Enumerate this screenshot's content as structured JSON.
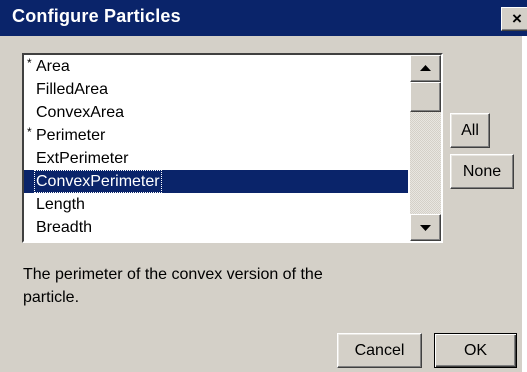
{
  "window": {
    "title": "Configure Particles",
    "close_glyph": "×",
    "close_icon": "close-icon"
  },
  "particle_list": {
    "items": [
      {
        "label": "Area",
        "marker": "*",
        "indent": false,
        "selected": false
      },
      {
        "label": "FilledArea",
        "marker": "",
        "indent": true,
        "selected": false
      },
      {
        "label": "ConvexArea",
        "marker": "",
        "indent": true,
        "selected": false
      },
      {
        "label": "Perimeter",
        "marker": "*",
        "indent": false,
        "selected": false
      },
      {
        "label": "ExtPerimeter",
        "marker": "",
        "indent": true,
        "selected": false
      },
      {
        "label": "ConvexPerimeter",
        "marker": "",
        "indent": true,
        "selected": true
      },
      {
        "label": "Length",
        "marker": "",
        "indent": true,
        "selected": false
      },
      {
        "label": "Breadth",
        "marker": "",
        "indent": true,
        "selected": false
      }
    ],
    "scroll_up_icon": "arrow-up-icon",
    "scroll_down_icon": "arrow-down-icon"
  },
  "side_buttons": {
    "all_label": "All",
    "none_label": "None"
  },
  "description": "The perimeter of the convex version of the particle.",
  "footer": {
    "cancel_label": "Cancel",
    "ok_label": "OK"
  },
  "colors": {
    "title_bar": "#0a246a",
    "selection": "#0a246a",
    "face": "#d4d0c8"
  }
}
